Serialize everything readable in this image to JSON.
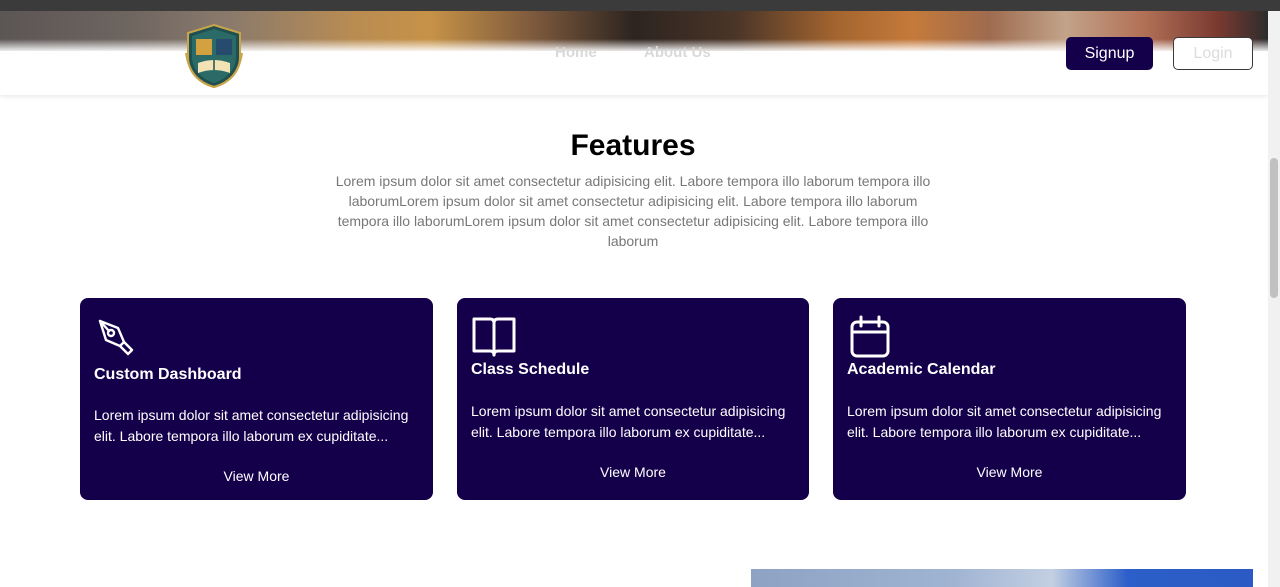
{
  "navbar": {
    "links": [
      {
        "label": "Home"
      },
      {
        "label": "About Us"
      }
    ],
    "signup_label": "Signup",
    "login_label": "Login"
  },
  "features": {
    "title": "Features",
    "description": "Lorem ipsum dolor sit amet consectetur adipisicing elit. Labore tempora illo laborum tempora illo laborumLorem ipsum dolor sit amet consectetur adipisicing elit. Labore tempora illo laborum tempora illo laborumLorem ipsum dolor sit amet consectetur adipisicing elit. Labore tempora illo laborum",
    "cards": [
      {
        "icon": "pen-nib-icon",
        "title": "Custom Dashboard",
        "text": "Lorem ipsum dolor sit amet consectetur adipisicing elit. Labore tempora illo laborum ex cupiditate...",
        "link": "View More"
      },
      {
        "icon": "book-icon",
        "title": "Class Schedule",
        "text": "Lorem ipsum dolor sit amet consectetur adipisicing elit. Labore tempora illo laborum ex cupiditate...",
        "link": "View More"
      },
      {
        "icon": "calendar-icon",
        "title": "Academic Calendar",
        "text": "Lorem ipsum dolor sit amet consectetur adipisicing elit. Labore tempora illo laborum ex cupiditate...",
        "link": "View More"
      }
    ]
  },
  "colors": {
    "primary": "#14004a",
    "muted_text": "#777777"
  }
}
